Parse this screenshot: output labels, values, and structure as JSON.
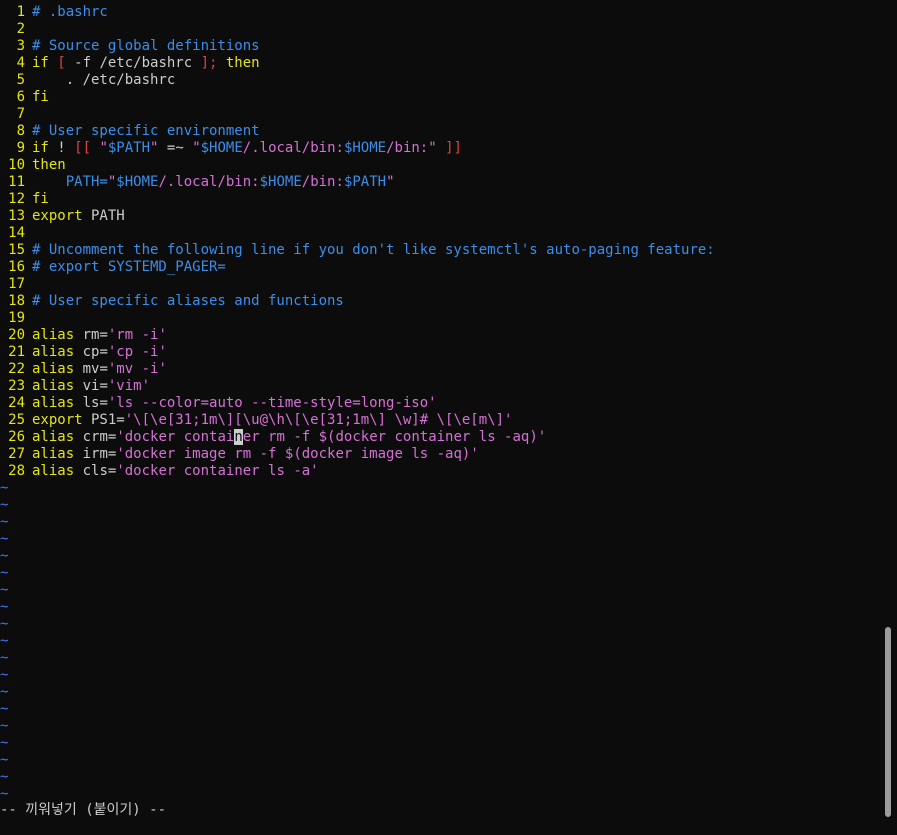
{
  "editor": {
    "mode_message": "-- 끼워넣기 (붙이기) --",
    "tilde": "~",
    "tilde_count": 19,
    "colors": {
      "background": "#0c0c0c",
      "line_number": "#e5e510",
      "comment": "#3b8eea",
      "keyword": "#e5e510",
      "string": "#d670d6",
      "variable": "#3b8eea",
      "bracket": "#e04040",
      "text": "#cccccc",
      "tilde": "#3b78ff"
    },
    "cursor": {
      "line": 26,
      "column": 22
    },
    "lines": [
      {
        "n": "1",
        "tokens": [
          {
            "t": "# .bashrc",
            "c": "comment"
          }
        ]
      },
      {
        "n": "2",
        "tokens": []
      },
      {
        "n": "3",
        "tokens": [
          {
            "t": "# Source global definitions",
            "c": "comment"
          }
        ]
      },
      {
        "n": "4",
        "tokens": [
          {
            "t": "if",
            "c": "keyword"
          },
          {
            "t": " ",
            "c": "text"
          },
          {
            "t": "[",
            "c": "bracket"
          },
          {
            "t": " -f /etc/bashrc ",
            "c": "text"
          },
          {
            "t": "];",
            "c": "bracket"
          },
          {
            "t": " then",
            "c": "keyword"
          }
        ]
      },
      {
        "n": "5",
        "tokens": [
          {
            "t": "    . /etc/bashrc",
            "c": "text"
          }
        ]
      },
      {
        "n": "6",
        "tokens": [
          {
            "t": "fi",
            "c": "keyword"
          }
        ]
      },
      {
        "n": "7",
        "tokens": []
      },
      {
        "n": "8",
        "tokens": [
          {
            "t": "# User specific environment",
            "c": "comment"
          }
        ]
      },
      {
        "n": "9",
        "tokens": [
          {
            "t": "if",
            "c": "keyword"
          },
          {
            "t": " ! ",
            "c": "text"
          },
          {
            "t": "[[",
            "c": "bracket"
          },
          {
            "t": " \"",
            "c": "string"
          },
          {
            "t": "$PATH",
            "c": "variable"
          },
          {
            "t": "\"",
            "c": "string"
          },
          {
            "t": " =~ ",
            "c": "text"
          },
          {
            "t": "\"",
            "c": "string"
          },
          {
            "t": "$HOME",
            "c": "variable"
          },
          {
            "t": "/.local/bin:",
            "c": "string"
          },
          {
            "t": "$HOME",
            "c": "variable"
          },
          {
            "t": "/bin:\" ",
            "c": "string"
          },
          {
            "t": "]]",
            "c": "bracket"
          }
        ]
      },
      {
        "n": "10",
        "tokens": [
          {
            "t": "then",
            "c": "keyword"
          }
        ]
      },
      {
        "n": "11",
        "tokens": [
          {
            "t": "    PATH=",
            "c": "variable"
          },
          {
            "t": "\"",
            "c": "string"
          },
          {
            "t": "$HOME",
            "c": "variable"
          },
          {
            "t": "/.local/bin:",
            "c": "string"
          },
          {
            "t": "$HOME",
            "c": "variable"
          },
          {
            "t": "/bin:",
            "c": "string"
          },
          {
            "t": "$PATH",
            "c": "variable"
          },
          {
            "t": "\"",
            "c": "string"
          }
        ]
      },
      {
        "n": "12",
        "tokens": [
          {
            "t": "fi",
            "c": "keyword"
          }
        ]
      },
      {
        "n": "13",
        "tokens": [
          {
            "t": "export",
            "c": "keyword"
          },
          {
            "t": " PATH",
            "c": "text"
          }
        ]
      },
      {
        "n": "14",
        "tokens": []
      },
      {
        "n": "15",
        "tokens": [
          {
            "t": "# Uncomment the following line if you don't like systemctl's auto-paging feature:",
            "c": "comment"
          }
        ]
      },
      {
        "n": "16",
        "tokens": [
          {
            "t": "# export SYSTEMD_PAGER=",
            "c": "comment"
          }
        ]
      },
      {
        "n": "17",
        "tokens": []
      },
      {
        "n": "18",
        "tokens": [
          {
            "t": "# User specific aliases and functions",
            "c": "comment"
          }
        ]
      },
      {
        "n": "19",
        "tokens": []
      },
      {
        "n": "20",
        "tokens": [
          {
            "t": "alias",
            "c": "keyword"
          },
          {
            "t": " rm=",
            "c": "text"
          },
          {
            "t": "'rm -i'",
            "c": "string"
          }
        ]
      },
      {
        "n": "21",
        "tokens": [
          {
            "t": "alias",
            "c": "keyword"
          },
          {
            "t": " cp=",
            "c": "text"
          },
          {
            "t": "'cp -i'",
            "c": "string"
          }
        ]
      },
      {
        "n": "22",
        "tokens": [
          {
            "t": "alias",
            "c": "keyword"
          },
          {
            "t": " mv=",
            "c": "text"
          },
          {
            "t": "'mv -i'",
            "c": "string"
          }
        ]
      },
      {
        "n": "23",
        "tokens": [
          {
            "t": "alias",
            "c": "keyword"
          },
          {
            "t": " vi=",
            "c": "text"
          },
          {
            "t": "'vim'",
            "c": "string"
          }
        ]
      },
      {
        "n": "24",
        "tokens": [
          {
            "t": "alias",
            "c": "keyword"
          },
          {
            "t": " ls=",
            "c": "text"
          },
          {
            "t": "'ls --color=auto --time-style=long-iso'",
            "c": "string"
          }
        ]
      },
      {
        "n": "25",
        "tokens": [
          {
            "t": "export",
            "c": "keyword"
          },
          {
            "t": " PS1=",
            "c": "text"
          },
          {
            "t": "'\\[\\e[31;1m\\][\\u@\\h\\[\\e[31;1m\\] \\w]# \\[\\e[m\\]'",
            "c": "string"
          }
        ]
      },
      {
        "n": "26",
        "tokens": [
          {
            "t": "alias",
            "c": "keyword"
          },
          {
            "t": " crm=",
            "c": "text"
          },
          {
            "t": "'docker contai",
            "c": "string"
          },
          {
            "t": "n",
            "c": "cursor"
          },
          {
            "t": "er rm -f $(docker container ls -aq)'",
            "c": "string"
          }
        ]
      },
      {
        "n": "27",
        "tokens": [
          {
            "t": "alias",
            "c": "keyword"
          },
          {
            "t": " irm=",
            "c": "text"
          },
          {
            "t": "'docker image rm -f $(docker image ls -aq)'",
            "c": "string"
          }
        ]
      },
      {
        "n": "28",
        "tokens": [
          {
            "t": "alias",
            "c": "keyword"
          },
          {
            "t": " cls=",
            "c": "text"
          },
          {
            "t": "'docker container ls -a'",
            "c": "string"
          }
        ]
      }
    ]
  }
}
